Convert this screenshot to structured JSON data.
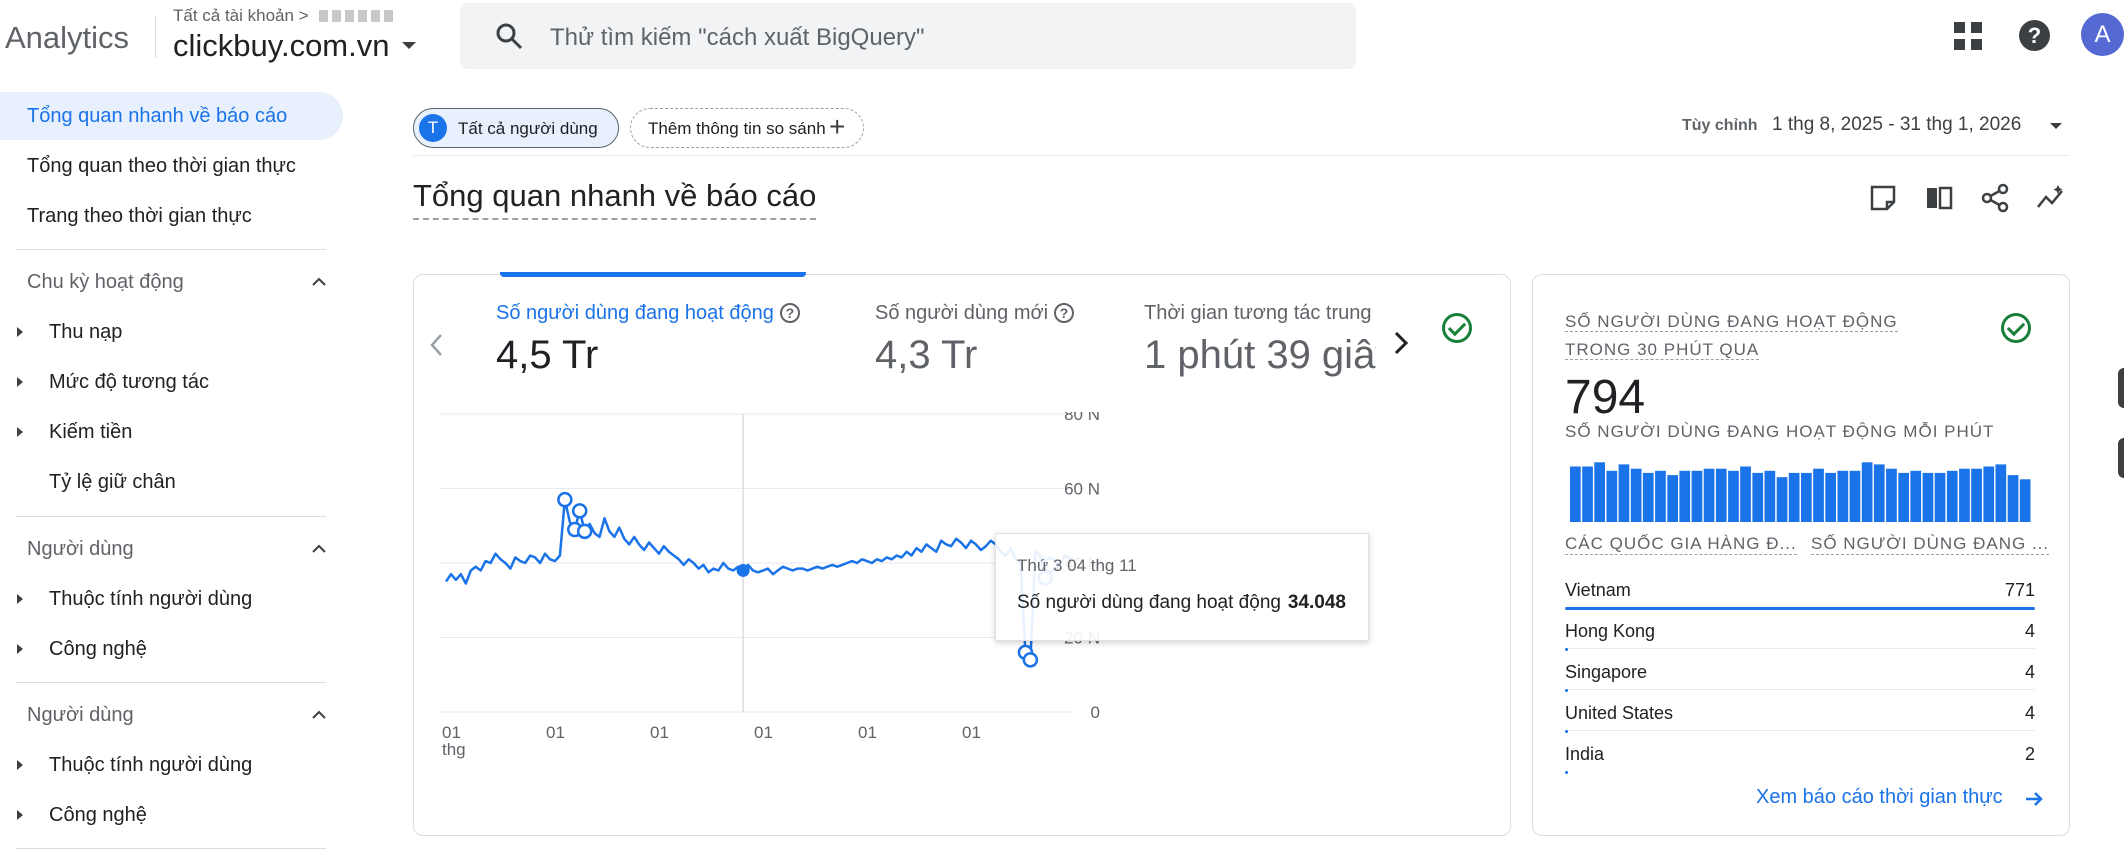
{
  "app": {
    "brand": "Analytics"
  },
  "account": {
    "path": "Tất cả tài khoản >",
    "property": "clickbuy.com.vn"
  },
  "search": {
    "placeholder": "Thử tìm kiếm \"cách xuất BigQuery\""
  },
  "header_icons": [
    "apps-icon",
    "help-icon"
  ],
  "user": {
    "avatar_letter": "A",
    "avatar_color": "#5469d4"
  },
  "sidebar": {
    "top_items": [
      "Tổng quan nhanh về báo cáo",
      "Tổng quan theo thời gian thực",
      "Trang theo thời gian thực"
    ],
    "sections": [
      {
        "title": "Chu kỳ hoạt động",
        "items": [
          "Thu nạp",
          "Mức độ tương tác",
          "Kiếm tiền",
          "Tỷ lệ giữ chân"
        ]
      },
      {
        "title": "Người dùng",
        "items": [
          "Thuộc tính người dùng",
          "Công nghệ"
        ]
      },
      {
        "title": "Người dùng",
        "items": [
          "Thuộc tính người dùng",
          "Công nghệ"
        ]
      }
    ]
  },
  "comparison": {
    "user_chip_letter": "T",
    "user_chip": "Tất cả người dùng",
    "add_chip": "Thêm thông tin so sánh"
  },
  "date": {
    "label": "Tùy chỉnh",
    "range": "1 thg 8, 2025 - 31 thg 1, 2026"
  },
  "page": {
    "title": "Tổng quan nhanh về báo cáo"
  },
  "toolbar_icons": [
    "note-icon",
    "compare-icon",
    "share-icon",
    "insights-icon"
  ],
  "metrics": [
    {
      "label": "Số người dùng đang hoạt động",
      "value": "4,5 Tr"
    },
    {
      "label": "Số người dùng mới",
      "value": "4,3 Tr"
    },
    {
      "label": "Thời gian tương tác trung",
      "value": "1 phút 39 giây"
    }
  ],
  "chart_data": {
    "type": "line",
    "title": "",
    "xlabel": "",
    "ylabel": "",
    "x_tick_labels": [
      "01 thg",
      "01",
      "01",
      "01",
      "01",
      "01"
    ],
    "y_tick_labels": [
      "0",
      "20 N",
      "40 N",
      "60 N",
      "80 N"
    ],
    "ylim": [
      0,
      80000
    ],
    "grid": true,
    "series": [
      {
        "color": "#1a73e8",
        "values": [
          35000,
          37000,
          35500,
          37000,
          34500,
          38000,
          39000,
          38000,
          40500,
          40000,
          42500,
          41000,
          40000,
          38500,
          41500,
          40500,
          40000,
          42000,
          41500,
          40000,
          42500,
          41000,
          40500,
          42000,
          57000,
          51000,
          49000,
          54000,
          48500,
          50500,
          48000,
          47000,
          52000,
          48500,
          47000,
          49500,
          46500,
          45000,
          47000,
          45000,
          43500,
          45500,
          44000,
          42500,
          44500,
          43000,
          42000,
          41000,
          39500,
          41000,
          40000,
          38500,
          39500,
          37500,
          38500,
          38000,
          40000,
          38500,
          38000,
          39000,
          38000,
          39500,
          38000,
          37500,
          38000,
          38500,
          37000,
          38000,
          39000,
          38500,
          38000,
          38500,
          38500,
          38000,
          38500,
          39000,
          38500,
          39000,
          39500,
          39000,
          39500,
          40000,
          40500,
          40000,
          41000,
          40500,
          40000,
          41000,
          40500,
          41500,
          41000,
          42000,
          41500,
          43000,
          42000,
          44000,
          43000,
          45000,
          44000,
          43000,
          46000,
          45000,
          44500,
          46500,
          45500,
          44000,
          46000,
          45000,
          43500,
          44500,
          46000,
          45000,
          43000,
          42000,
          44000,
          41000,
          40000,
          16000,
          14000,
          43000,
          42000,
          36000,
          39500,
          38000,
          40000,
          42000,
          41000
        ]
      }
    ],
    "tooltip": {
      "date": "Thứ 3 04 thg 11",
      "metric": "Số người dùng đang hoạt động",
      "value": "34.048",
      "point_index": 60
    }
  },
  "realtime": {
    "title": "SỐ NGƯỜI DÙNG ĐANG HOẠT ĐỘNG TRONG 30 PHÚT QUA",
    "value": "794",
    "per_minute_label": "SỐ NGƯỜI DÙNG ĐANG HOẠT ĐỘNG MỖI PHÚT",
    "per_minute_values": [
      26,
      26,
      28,
      24,
      27,
      25,
      23,
      24,
      22,
      24,
      24,
      25,
      25,
      24,
      26,
      23,
      24,
      21,
      23,
      23,
      25,
      23,
      24,
      24,
      28,
      27,
      25,
      23,
      24,
      23,
      23,
      24,
      25,
      25,
      26,
      27,
      22,
      20
    ],
    "col_country": "CÁC QUỐC GIA HÀNG Đ...",
    "col_users": "SỐ NGƯỜI DÙNG ĐANG ...",
    "rows": [
      {
        "country": "Vietnam",
        "users": "771",
        "share": 1.0
      },
      {
        "country": "Hong Kong",
        "users": "4",
        "share": 0.005
      },
      {
        "country": "Singapore",
        "users": "4",
        "share": 0.005
      },
      {
        "country": "United States",
        "users": "4",
        "share": 0.005
      },
      {
        "country": "India",
        "users": "2",
        "share": 0.003
      }
    ],
    "link": "Xem báo cáo thời gian thực"
  }
}
